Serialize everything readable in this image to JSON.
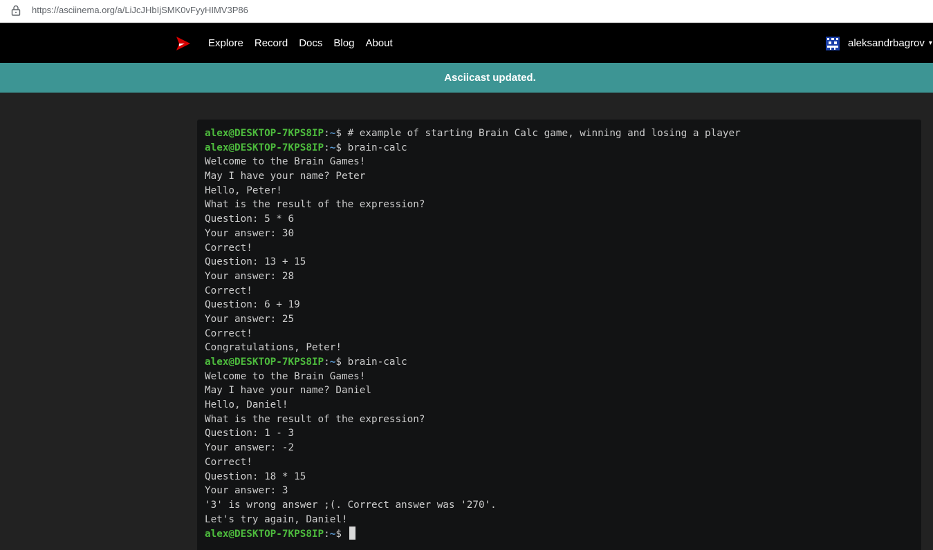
{
  "browser": {
    "url": "https://asciinema.org/a/LiJcJHbIjSMK0vFyyHIMV3P86",
    "lock_icon": "lock-icon"
  },
  "navbar": {
    "logo_icon": "asciinema-play-logo-icon",
    "links": [
      "Explore",
      "Record",
      "Docs",
      "Blog",
      "About"
    ],
    "username": "aleksandrbagrov",
    "avatar_icon": "user-avatar-icon"
  },
  "flash": {
    "message": "Asciicast updated."
  },
  "colors": {
    "accent_red": "#d40000",
    "flash_bg": "#3d9594",
    "prompt_green": "#4dbb3d",
    "prompt_blue": "#5b9bd5"
  },
  "terminal": {
    "lines": [
      {
        "prompt": {
          "user": "alex@DESKTOP-7KPS8IP",
          "sep": ":",
          "path": "~",
          "sign": "$"
        },
        "text": " # example of starting Brain Calc game, winning and losing a player"
      },
      {
        "prompt": {
          "user": "alex@DESKTOP-7KPS8IP",
          "sep": ":",
          "path": "~",
          "sign": "$"
        },
        "text": " brain-calc"
      },
      {
        "text": "Welcome to the Brain Games!"
      },
      {
        "text": "May I have your name? Peter"
      },
      {
        "text": "Hello, Peter!"
      },
      {
        "text": "What is the result of the expression?"
      },
      {
        "text": "Question: 5 * 6"
      },
      {
        "text": "Your answer: 30"
      },
      {
        "text": "Correct!"
      },
      {
        "text": "Question: 13 + 15"
      },
      {
        "text": "Your answer: 28"
      },
      {
        "text": "Correct!"
      },
      {
        "text": "Question: 6 + 19"
      },
      {
        "text": "Your answer: 25"
      },
      {
        "text": "Correct!"
      },
      {
        "text": "Congratulations, Peter!"
      },
      {
        "prompt": {
          "user": "alex@DESKTOP-7KPS8IP",
          "sep": ":",
          "path": "~",
          "sign": "$"
        },
        "text": " brain-calc"
      },
      {
        "text": "Welcome to the Brain Games!"
      },
      {
        "text": "May I have your name? Daniel"
      },
      {
        "text": "Hello, Daniel!"
      },
      {
        "text": "What is the result of the expression?"
      },
      {
        "text": "Question: 1 - 3"
      },
      {
        "text": "Your answer: -2"
      },
      {
        "text": "Correct!"
      },
      {
        "text": "Question: 18 * 15"
      },
      {
        "text": "Your answer: 3"
      },
      {
        "text": "'3' is wrong answer ;(. Correct answer was '270'."
      },
      {
        "text": "Let's try again, Daniel!"
      },
      {
        "prompt": {
          "user": "alex@DESKTOP-7KPS8IP",
          "sep": ":",
          "path": "~",
          "sign": "$"
        },
        "text": " ",
        "cursor": true
      }
    ]
  }
}
